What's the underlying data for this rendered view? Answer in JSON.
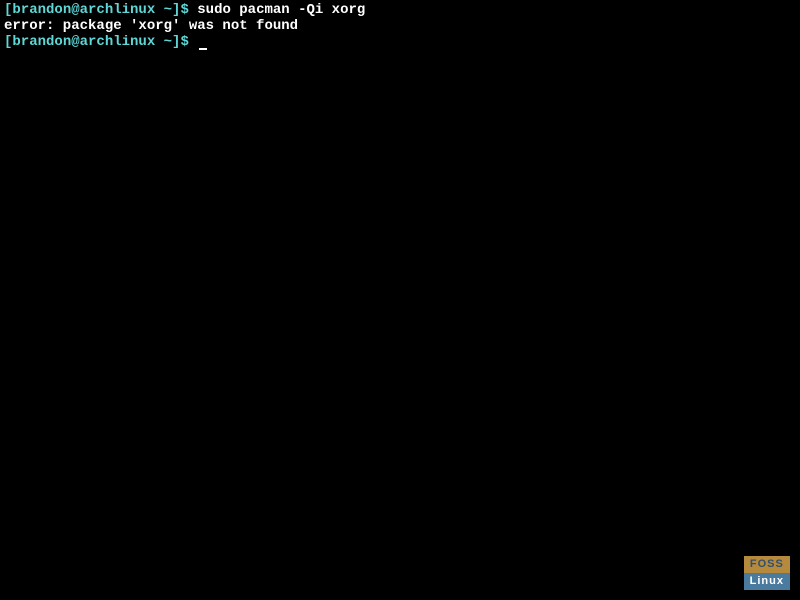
{
  "terminal": {
    "lines": [
      {
        "prompt_open": "[",
        "user_host": "brandon@archlinux",
        "path": " ~",
        "prompt_close": "]$",
        "command": " sudo pacman -Qi xorg"
      },
      {
        "output": "error: package 'xorg' was not found"
      },
      {
        "prompt_open": "[",
        "user_host": "brandon@archlinux",
        "path": " ~",
        "prompt_close": "]$",
        "command": " "
      }
    ]
  },
  "logo": {
    "top": "FOSS",
    "bottom": "Linux"
  }
}
